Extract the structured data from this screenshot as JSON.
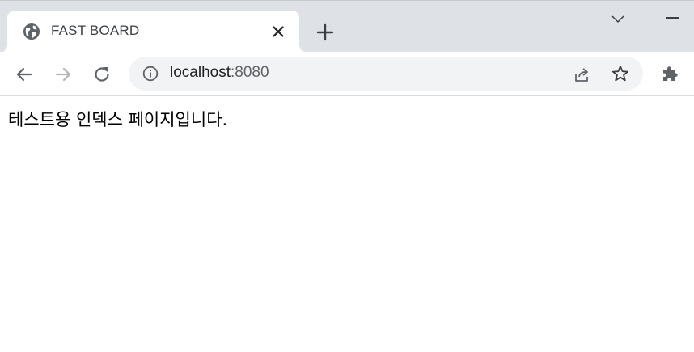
{
  "tab": {
    "title": "FAST BOARD",
    "favicon": "globe-icon"
  },
  "address_bar": {
    "host": "localhost",
    "port": ":8080",
    "security_icon": "info-icon"
  },
  "page": {
    "text": "테스트용 인덱스 페이지입니다."
  },
  "colors": {
    "tabstrip_bg": "#dee1e6",
    "omnibox_bg": "#f1f3f4",
    "icon": "#5f6368",
    "disabled_icon": "#b3b5b8",
    "text": "#202124"
  }
}
